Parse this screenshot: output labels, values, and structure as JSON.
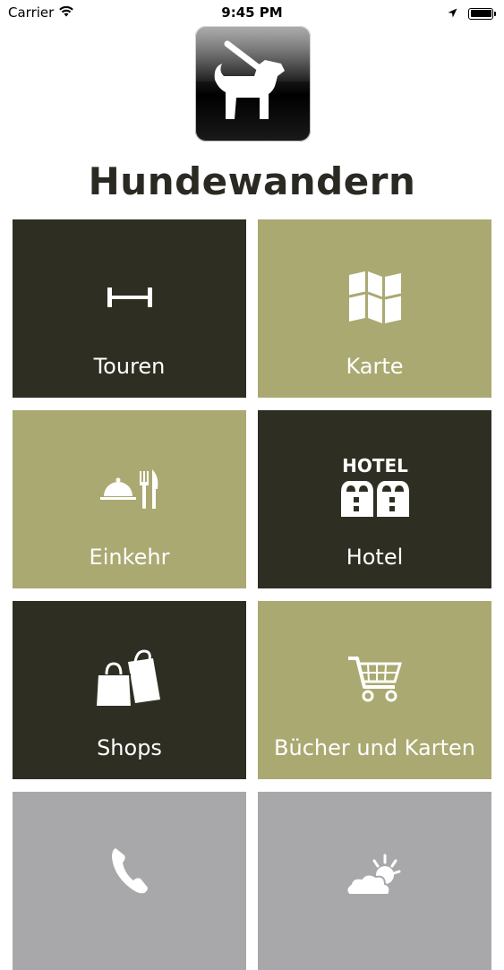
{
  "status_bar": {
    "carrier": "Carrier",
    "time": "9:45 PM"
  },
  "app": {
    "title": "Hundewandern"
  },
  "tiles": [
    {
      "label": "Touren",
      "icon": "distance-icon"
    },
    {
      "label": "Karte",
      "icon": "map-icon"
    },
    {
      "label": "Einkehr",
      "icon": "dining-icon"
    },
    {
      "label": "Hotel",
      "icon": "hotel-icon",
      "icon_text": "HOTEL"
    },
    {
      "label": "Shops",
      "icon": "shopping-bags-icon"
    },
    {
      "label": "Bücher und Karten",
      "icon": "shopping-cart-icon"
    },
    {
      "label": "",
      "icon": "phone-icon"
    },
    {
      "label": "",
      "icon": "weather-icon"
    }
  ],
  "colors": {
    "dark_tile": "#2f2e22",
    "olive_tile": "#aaa971",
    "gray_tile": "#a8a8aa",
    "title": "#2a2a22"
  }
}
